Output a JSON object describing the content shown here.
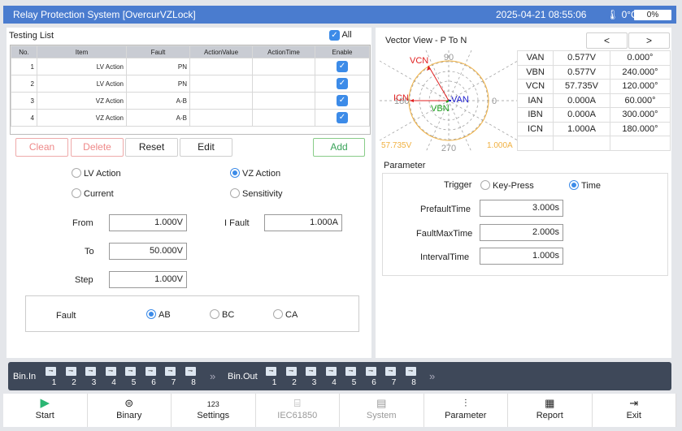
{
  "title": "Relay Protection System [OvercurVZLock]",
  "datetime": "2025-04-21 08:55:06",
  "temperature": "0°C",
  "battery": "0%",
  "testing_list": {
    "title": "Testing List",
    "all_label": "All",
    "all_checked": true,
    "columns": [
      "No.",
      "Item",
      "Fault",
      "ActionValue",
      "ActionTime",
      "Enable"
    ],
    "rows": [
      {
        "no": "1",
        "item": "LV Action",
        "fault": "PN",
        "value": "",
        "time": "",
        "enable": true
      },
      {
        "no": "2",
        "item": "LV Action",
        "fault": "PN",
        "value": "",
        "time": "",
        "enable": true
      },
      {
        "no": "3",
        "item": "VZ Action",
        "fault": "A-B",
        "value": "",
        "time": "",
        "enable": true
      },
      {
        "no": "4",
        "item": "VZ Action",
        "fault": "A-B",
        "value": "",
        "time": "",
        "enable": true
      }
    ],
    "buttons": {
      "clean": "Clean",
      "delete": "Delete",
      "reset": "Reset",
      "edit": "Edit",
      "add": "Add"
    }
  },
  "mode": {
    "options": [
      "LV Action",
      "VZ Action",
      "Current",
      "Sensitivity"
    ],
    "selected": "VZ Action"
  },
  "fields": {
    "from_label": "From",
    "from": "1.000V",
    "to_label": "To",
    "to": "50.000V",
    "step_label": "Step",
    "step": "1.000V",
    "ifault_label": "I Fault",
    "ifault": "1.000A"
  },
  "fault": {
    "label": "Fault",
    "options": [
      "AB",
      "BC",
      "CA"
    ],
    "selected": "AB"
  },
  "vector": {
    "title": "Vector View - P To N",
    "prev": "<",
    "next": ">",
    "axis_labels": {
      "deg90": "90",
      "deg0": "0",
      "deg180": "180",
      "deg270": "270"
    },
    "voltage_scale": "57.735V",
    "current_scale": "1.000A",
    "rows": [
      {
        "name": "VAN",
        "mag": "0.577V",
        "ang": "0.000°",
        "color": "#2020d0"
      },
      {
        "name": "VBN",
        "mag": "0.577V",
        "ang": "240.000°",
        "color": "#20a020"
      },
      {
        "name": "VCN",
        "mag": "57.735V",
        "ang": "120.000°",
        "color": "#e02020"
      },
      {
        "name": "IAN",
        "mag": "0.000A",
        "ang": "60.000°"
      },
      {
        "name": "IBN",
        "mag": "0.000A",
        "ang": "300.000°"
      },
      {
        "name": "ICN",
        "mag": "1.000A",
        "ang": "180.000°",
        "color": "#e02020"
      }
    ]
  },
  "parameter": {
    "title": "Parameter",
    "trigger_label": "Trigger",
    "trigger_options": [
      "Key-Press",
      "Time"
    ],
    "trigger_selected": "Time",
    "prefault_label": "PrefaultTime",
    "prefault": "3.000s",
    "faultmax_label": "FaultMaxTime",
    "faultmax": "2.000s",
    "interval_label": "IntervalTime",
    "interval": "1.000s"
  },
  "binbar": {
    "in_label": "Bin.In",
    "out_label": "Bin.Out",
    "channels": [
      "1",
      "2",
      "3",
      "4",
      "5",
      "6",
      "7",
      "8"
    ],
    "more": "»"
  },
  "toolbar": [
    {
      "label": "Start",
      "icon": "play-icon",
      "enabled": true
    },
    {
      "label": "Binary",
      "icon": "toggle-icon",
      "enabled": true
    },
    {
      "label": "Settings",
      "icon": "numeric-icon",
      "enabled": true
    },
    {
      "label": "IEC61850",
      "icon": "network-icon",
      "enabled": false
    },
    {
      "label": "System",
      "icon": "system-icon",
      "enabled": false
    },
    {
      "label": "Parameter",
      "icon": "sliders-icon",
      "enabled": true
    },
    {
      "label": "Report",
      "icon": "report-icon",
      "enabled": true
    },
    {
      "label": "Exit",
      "icon": "exit-icon",
      "enabled": true
    }
  ]
}
